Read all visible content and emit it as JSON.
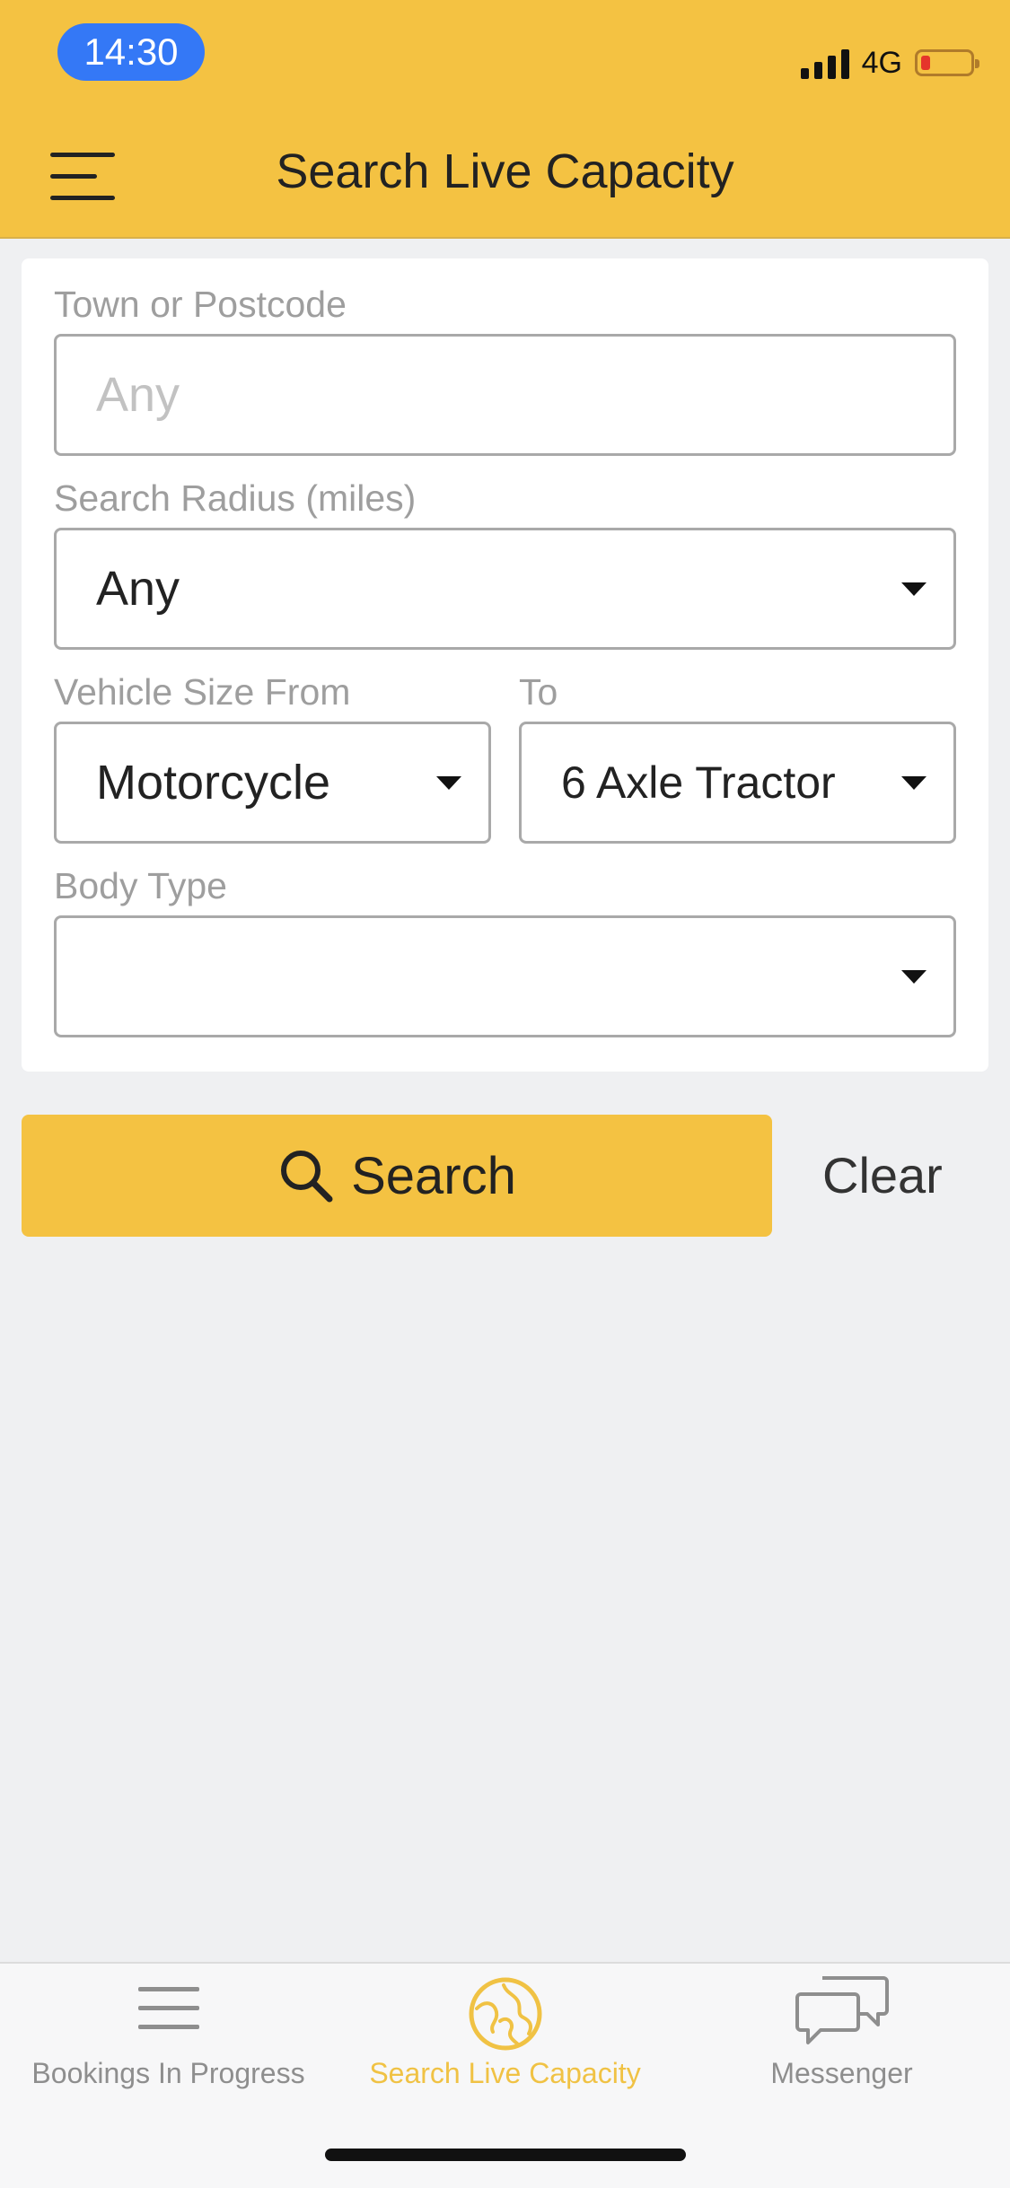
{
  "status_bar": {
    "time": "14:30",
    "network": "4G"
  },
  "header": {
    "title": "Search Live Capacity"
  },
  "form": {
    "town_label": "Town or Postcode",
    "town_placeholder": "Any",
    "town_value": "",
    "radius_label": "Search Radius (miles)",
    "radius_value": "Any",
    "vehicle_from_label": "Vehicle Size From",
    "vehicle_from_value": "Motorcycle",
    "vehicle_to_label": "To",
    "vehicle_to_value": "6 Axle Tractor",
    "body_type_label": "Body Type",
    "body_type_value": ""
  },
  "actions": {
    "search_label": "Search",
    "clear_label": "Clear"
  },
  "tabs": [
    {
      "label": "Bookings In Progress",
      "icon": "list-icon",
      "active": false
    },
    {
      "label": "Search Live Capacity",
      "icon": "globe-icon",
      "active": true
    },
    {
      "label": "Messenger",
      "icon": "chat-icon",
      "active": false
    }
  ],
  "colors": {
    "accent": "#f4c242",
    "time_pill": "#3478f6",
    "background": "#eff0f2",
    "active_tab": "#f0c244"
  }
}
